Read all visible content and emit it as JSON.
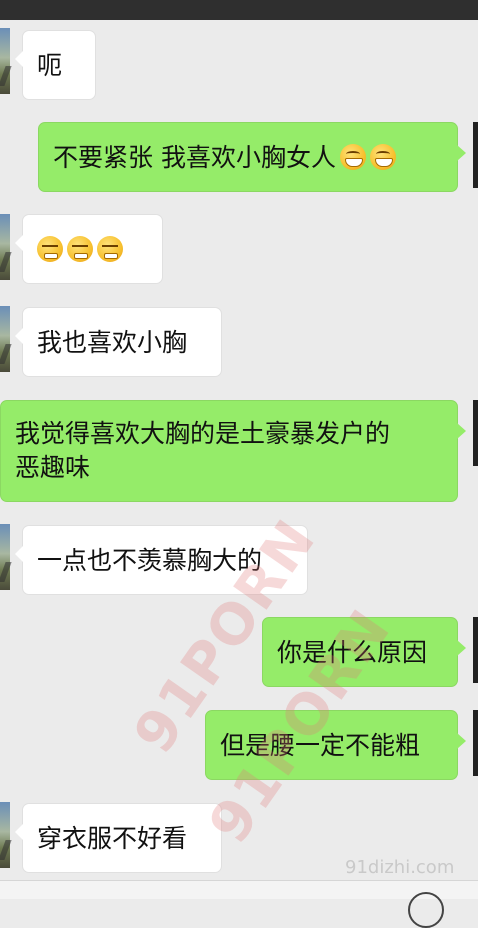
{
  "messages": [
    {
      "side": "in",
      "text": "呃"
    },
    {
      "side": "out",
      "text": "不要紧张 我喜欢小胸女人",
      "emojis": [
        "grin",
        "grin"
      ]
    },
    {
      "side": "in",
      "text": "",
      "emojis": [
        "sweat",
        "sweat",
        "sweat"
      ]
    },
    {
      "side": "in",
      "text": "我也喜欢小胸"
    },
    {
      "side": "out",
      "line1": "我觉得喜欢大胸的是土豪暴发户的",
      "line2": "恶趣味"
    },
    {
      "side": "in",
      "text": "一点也不羡慕胸大的"
    },
    {
      "side": "out",
      "text": "你是什么原因"
    },
    {
      "side": "out",
      "text": "但是腰一定不能粗"
    },
    {
      "side": "in",
      "text": "穿衣服不好看"
    }
  ],
  "watermark": {
    "text1": "91PORN",
    "text2": "91PORN",
    "site": "91dizhi.com"
  },
  "emoji_icons": {
    "grin": "grinning-face-icon",
    "sweat": "sweat-smile-icon"
  }
}
